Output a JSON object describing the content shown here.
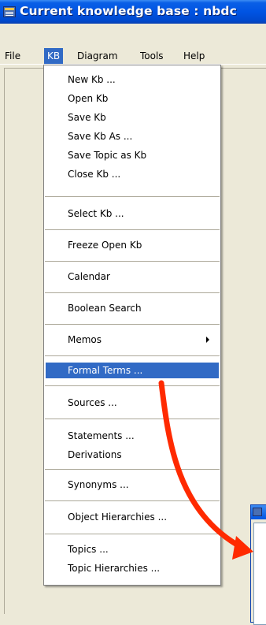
{
  "window": {
    "title": "Current knowledge base : nbdc"
  },
  "menubar": {
    "items": [
      {
        "label": "File"
      },
      {
        "label": "KB"
      },
      {
        "label": "Diagram"
      },
      {
        "label": "Tools"
      },
      {
        "label": "Help"
      }
    ],
    "active": "KB"
  },
  "kb_menu": {
    "items": [
      {
        "label": "New Kb ..."
      },
      {
        "label": "Open Kb"
      },
      {
        "label": "Save Kb"
      },
      {
        "label": "Save Kb As ..."
      },
      {
        "label": "Save Topic as Kb"
      },
      {
        "label": "Close Kb ..."
      },
      {
        "label": "Select Kb ..."
      },
      {
        "label": "Freeze Open Kb"
      },
      {
        "label": "Calendar"
      },
      {
        "label": "Boolean Search"
      },
      {
        "label": "Memos",
        "has_submenu": true
      },
      {
        "label": "Formal Terms ...",
        "highlighted": true
      },
      {
        "label": "Sources ..."
      },
      {
        "label": "Statements ..."
      },
      {
        "label": "Derivations"
      },
      {
        "label": "Synonyms ..."
      },
      {
        "label": "Object Hierarchies ..."
      },
      {
        "label": "Topics ..."
      },
      {
        "label": "Topic Hierarchies ..."
      }
    ]
  },
  "colors": {
    "titlebar": "#0054e3",
    "menu_highlight": "#316ac5",
    "annotation_arrow": "#ff2a00",
    "window_bg": "#ece9d8"
  }
}
